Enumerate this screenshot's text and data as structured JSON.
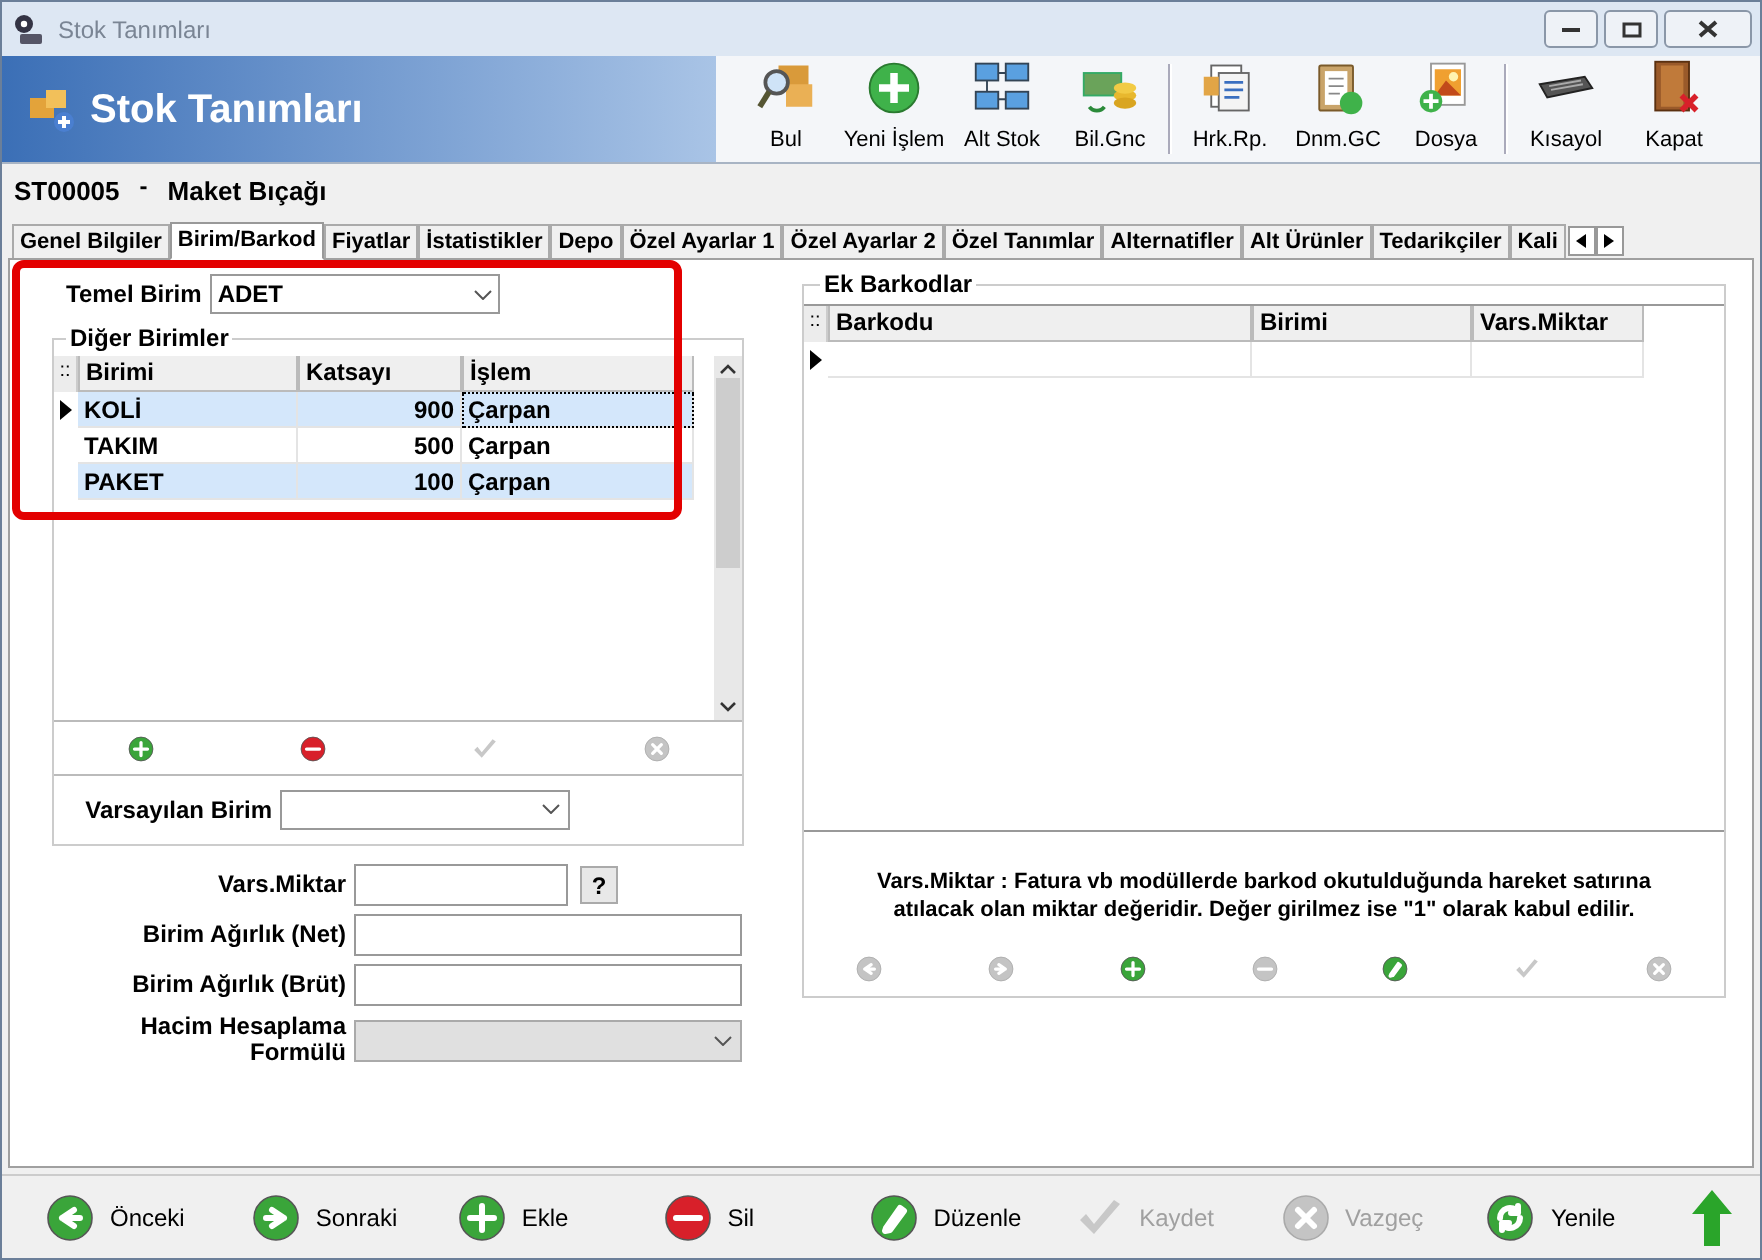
{
  "window": {
    "title": "Stok Tanımları"
  },
  "header": {
    "title": "Stok Tanımları"
  },
  "toolbar": [
    {
      "label": "Bul",
      "kind": "find",
      "separator_after": false
    },
    {
      "label": "Yeni İşlem",
      "kind": "new",
      "separator_after": false
    },
    {
      "label": "Alt Stok",
      "kind": "network",
      "separator_after": false
    },
    {
      "label": "Bil.Gnc",
      "kind": "money",
      "separator_after": true
    },
    {
      "label": "Hrk.Rp.",
      "kind": "report",
      "separator_after": false
    },
    {
      "label": "Dnm.GC",
      "kind": "clipboard",
      "separator_after": false
    },
    {
      "label": "Dosya",
      "kind": "files",
      "separator_after": true
    },
    {
      "label": "Kısayol",
      "kind": "keyboard",
      "separator_after": false
    },
    {
      "label": "Kapat",
      "kind": "exit",
      "separator_after": false
    }
  ],
  "record": {
    "code": "ST00005",
    "separator": "-",
    "name": "Maket Bıçağı"
  },
  "tabs": [
    {
      "label": "Genel Bilgiler",
      "selected": false
    },
    {
      "label": "Birim/Barkod",
      "selected": true
    },
    {
      "label": "Fiyatlar",
      "selected": false
    },
    {
      "label": "İstatistikler",
      "selected": false
    },
    {
      "label": "Depo",
      "selected": false
    },
    {
      "label": "Özel Ayarlar 1",
      "selected": false
    },
    {
      "label": "Özel Ayarlar 2",
      "selected": false
    },
    {
      "label": "Özel Tanımlar",
      "selected": false
    },
    {
      "label": "Alternatifler",
      "selected": false
    },
    {
      "label": "Alt Ürünler",
      "selected": false
    },
    {
      "label": "Tedarikçiler",
      "selected": false
    },
    {
      "label": "Kali",
      "selected": false
    }
  ],
  "units": {
    "base_label": "Temel Birim",
    "base_value": "ADET",
    "highlighted": true,
    "group_title": "Diğer Birimler",
    "handle": "::",
    "columns": [
      "Birimi",
      "Katsayı",
      "İşlem"
    ],
    "rows": [
      {
        "unit": "KOLİ",
        "factor": "900",
        "operation": "Çarpan",
        "current": true
      },
      {
        "unit": "TAKIM",
        "factor": "500",
        "operation": "Çarpan",
        "current": false
      },
      {
        "unit": "PAKET",
        "factor": "100",
        "operation": "Çarpan",
        "current": false
      }
    ],
    "actions": [
      {
        "kind": "add",
        "disabled": false
      },
      {
        "kind": "delete",
        "disabled": false
      },
      {
        "kind": "save",
        "disabled": true
      },
      {
        "kind": "cancel",
        "disabled": true
      }
    ],
    "default_label": "Varsayılan Birim"
  },
  "form": [
    {
      "label": "Vars.Miktar",
      "kind": "help",
      "help": "?"
    },
    {
      "label": "Birim Ağırlık (Net)",
      "kind": "text"
    },
    {
      "label": "Birim Ağırlık (Brüt)",
      "kind": "text"
    },
    {
      "label": "Hacim Hesaplama Formülü",
      "kind": "select",
      "disabled": true
    }
  ],
  "barcodes": {
    "group_title": "Ek Barkodlar",
    "columns": [
      "Barkodu",
      "Birimi",
      "Vars.Miktar"
    ],
    "handle": "::",
    "note": "Vars.Miktar : Fatura vb modüllerde barkod okutulduğunda hareket satırına atılacak olan miktar değeridir. Değer girilmez ise \"1\" olarak kabul edilir.",
    "actions": [
      {
        "kind": "prev",
        "disabled": true
      },
      {
        "kind": "next",
        "disabled": true
      },
      {
        "kind": "add",
        "disabled": false
      },
      {
        "kind": "delete",
        "disabled": true
      },
      {
        "kind": "edit",
        "disabled": false
      },
      {
        "kind": "save",
        "disabled": true
      },
      {
        "kind": "cancel",
        "disabled": true
      }
    ]
  },
  "footer": [
    {
      "label": "Önceki",
      "kind": "prev",
      "disabled": false
    },
    {
      "label": "Sonraki",
      "kind": "next",
      "disabled": false
    },
    {
      "label": "Ekle",
      "kind": "add",
      "disabled": false
    },
    {
      "label": "Sil",
      "kind": "delete",
      "disabled": false
    },
    {
      "label": "Düzenle",
      "kind": "edit",
      "disabled": false
    },
    {
      "label": "Kaydet",
      "kind": "save",
      "disabled": true
    },
    {
      "label": "Vazgeç",
      "kind": "cancel",
      "disabled": true
    },
    {
      "label": "Yenile",
      "kind": "refresh",
      "disabled": false
    }
  ]
}
